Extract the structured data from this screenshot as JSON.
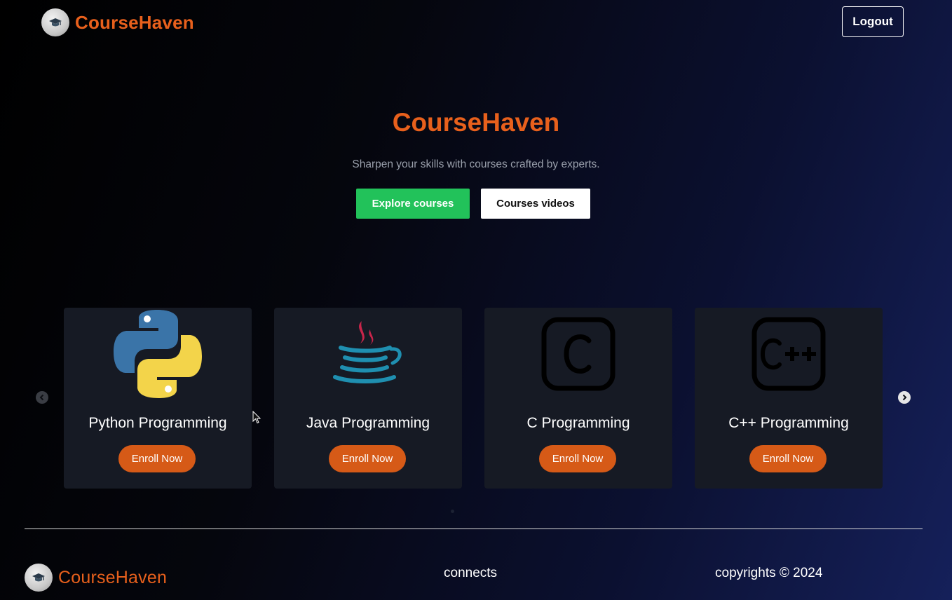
{
  "header": {
    "brand": "CourseHaven",
    "logout_label": "Logout"
  },
  "hero": {
    "title": "CourseHaven",
    "subtitle": "Sharpen your skills with courses crafted by experts.",
    "explore_label": "Explore courses",
    "videos_label": "Courses videos"
  },
  "courses": [
    {
      "title": "Python Programming",
      "button": "Enroll Now",
      "icon": "python-logo-icon"
    },
    {
      "title": "Java Programming",
      "button": "Enroll Now",
      "icon": "java-logo-icon"
    },
    {
      "title": "C Programming",
      "button": "Enroll Now",
      "icon": "c-logo-icon"
    },
    {
      "title": "C++ Programming",
      "button": "Enroll Now",
      "icon": "cpp-logo-icon"
    }
  ],
  "carousel": {
    "prev_icon": "chevron-left-icon",
    "next_icon": "chevron-right-icon"
  },
  "footer": {
    "brand": "CourseHaven",
    "connects_heading": "connects",
    "copyright": "copyrights © 2024"
  },
  "colors": {
    "brand_orange": "#e8601c",
    "enroll_orange": "#d65a17",
    "explore_green": "#22c25a",
    "card_bg": "#161a24"
  }
}
